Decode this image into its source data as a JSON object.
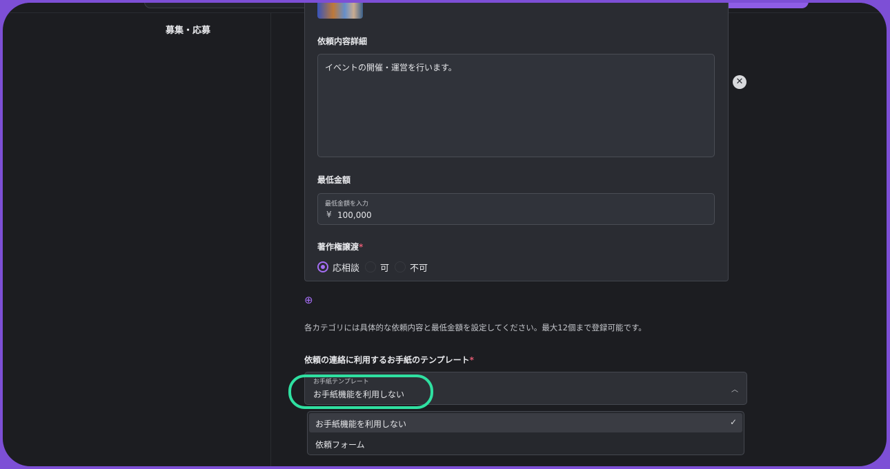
{
  "sidebar": {
    "section_label": "募集・応募"
  },
  "card": {
    "detail_label": "依頼内容詳細",
    "detail_value": "イベントの開催・運営を行います。",
    "min_price_label": "最低金額",
    "min_price_input_label": "最低金額を入力",
    "currency_symbol": "¥",
    "min_price_value": "100,000",
    "copyright_label": "著作権譲渡",
    "required_mark": "*",
    "copyright_options": [
      {
        "label": "応相談",
        "selected": true
      },
      {
        "label": "可",
        "selected": false
      },
      {
        "label": "不可",
        "selected": false
      }
    ]
  },
  "icons": {
    "remove": "close-icon",
    "add": "plus-circle-icon",
    "check": "check-icon",
    "chevron": "chevron-up-icon"
  },
  "help_text": "各カテゴリには具体的な依頼内容と最低金額を設定してください。最大12個まで登録可能です。",
  "template": {
    "label": "依頼の連絡に利用するお手紙のテンプレート",
    "required_mark": "*",
    "select_label": "お手紙テンプレート",
    "selected_value": "お手紙機能を利用しない",
    "options": [
      "お手紙機能を利用しない",
      "依頼フォーム"
    ]
  },
  "colors": {
    "accent": "#a56ef5",
    "highlight": "#2fe0a1",
    "frame": "#7d4fd6",
    "required": "#e35a72"
  }
}
